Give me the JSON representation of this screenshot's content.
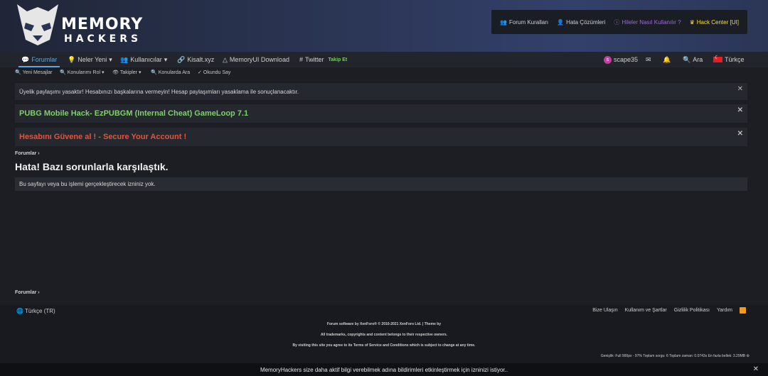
{
  "header": {
    "logo_line1": "MEMORY",
    "logo_line2": "HACKERS",
    "links": [
      {
        "label": "Forum Kuralları",
        "icon": "users-icon"
      },
      {
        "label": "Hata Çözümleri",
        "icon": "user-icon"
      },
      {
        "label": "Hileler Nasıl Kullanılır ?",
        "icon": "info-icon",
        "color": "#9a6bd6"
      },
      {
        "label": "Hack Center [UI]",
        "icon": "crown-icon",
        "color": "#f0e03a"
      }
    ]
  },
  "nav": {
    "forumlar": "Forumlar",
    "neler_yeni": "Neler Yeni",
    "kullanicilar": "Kullanıcılar",
    "kisalt": "Kisalt.xyz",
    "memoryui": "MemoryUI Download",
    "twitter": "Twitter",
    "twitter_badge": "Takip Et",
    "user": "scape35",
    "user_initial": "s",
    "search": "Ara",
    "language": "Türkçe"
  },
  "subnav": {
    "yeni_mesajlar": "Yeni Mesajlar",
    "konularim_rol": "Konularımı Rol",
    "takipler": "Takipler",
    "konularda_ara": "Konularda Ara",
    "okundu_say": "Okundu Say"
  },
  "notices": {
    "n1": "Üyelik paylaşımı yasaktır! Hesabınızı başkalarına vermeyin! Hesap paylaşımları yasaklama ile sonuçlanacaktır.",
    "n2": "PUBG Mobile Hack- EzPUBGM (Internal Cheat) GameLoop 7.1",
    "n3": "Hesabını Güvene al ! - Secure Your Account !"
  },
  "main": {
    "breadcrumb": "Forumlar",
    "title": "Hata! Bazı sorunlarla karşılaştık.",
    "error": "Bu sayfayı veya bu işlemi gerçekleştirecek izniniz yok.",
    "breadcrumb_bottom": "Forumlar"
  },
  "footer": {
    "language": "Türkçe (TR)",
    "links": [
      "Bize Ulaşın",
      "Kullanım ve Şartlar",
      "Gizlilik Politikası",
      "Yardım"
    ],
    "line1": "Forum software by XenForo® © 2010-2021 XenForo Ltd. | Theme by",
    "line2": "All trademarks, copyrights and content belongs to their respective owners.",
    "line3": "By visiting this site you agree to its Terms of Service and Conditions which is subject to change at any time.",
    "stats": "Genişlik: Full 900px - 97%   Toplam sorgu: 6   Toplam zaman: 0.0743s   En fazla bellek: 3.29MB"
  },
  "cookie": {
    "text": "MemoryHackers size daha aktif bilgi verebilmek adına bildirimleri etkinleştirmek için izninizi istiyor.."
  }
}
